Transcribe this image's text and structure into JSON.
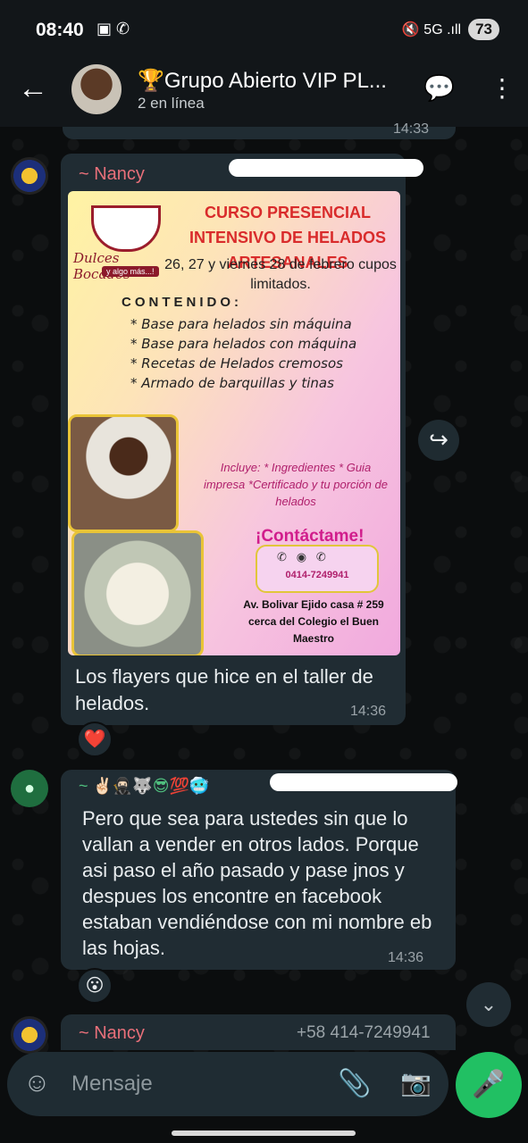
{
  "status_bar": {
    "time": "08:40",
    "left_icons": "▣ ✆",
    "right_icons": "🔇 5G .ıll",
    "battery": "73"
  },
  "header": {
    "title": "🏆Grupo Abierto VIP PL...",
    "subtitle": "2 en línea",
    "back_icon": "←",
    "call_icon": "💬",
    "menu_icon": "⋮"
  },
  "messages": {
    "prev": {
      "time": "14:33"
    },
    "nancy_image": {
      "sender": "~ Nancy",
      "flyer": {
        "title": "CURSO PRESENCIAL INTENSIVO DE HELADOS ARTESANALES",
        "logo_text": "Dulces Bocados",
        "logo_sub": "y algo más...!",
        "dates": "26, 27 y viernes 28 de febrero cupos limitados.",
        "contenido_label": "CONTENIDO:",
        "items": [
          "* Base para helados sin máquina",
          "* Base para helados con máquina",
          "*  Recetas de Helados cremosos",
          "*    Armado de barquillas y tinas"
        ],
        "incluye": "Incluye:  * Ingredientes * Guia impresa *Certificado y tu porción de helados",
        "contact": "¡Contáctame!",
        "phone": "0414-7249941",
        "address": "Av. Bolivar Ejido casa # 259 cerca del Colegio el Buen Maestro"
      },
      "caption": "Los flayers que hice en el taller de helados.",
      "time": "14:36",
      "reaction": "❤️"
    },
    "second": {
      "sender": "~ ✌🏻🥷🏻🐺😎💯🥶",
      "text": "Pero que sea para ustedes sin que lo vallan a vender en otros lados. Porque asi paso el año pasado y pase jnos y despues los encontre en facebook estaban vendiéndose con mi nombre eb las hojas.",
      "time": "14:36",
      "reaction": "😮"
    },
    "last": {
      "sender": "~ Nancy",
      "phone": "+58 414-7249941"
    }
  },
  "input": {
    "placeholder": "Mensaje",
    "emoji_icon": "☺",
    "attach_icon": "📎",
    "camera_icon": "📷",
    "mic_icon": "🎤"
  },
  "forward_icon": "↪",
  "scroll_icon": "⌄"
}
